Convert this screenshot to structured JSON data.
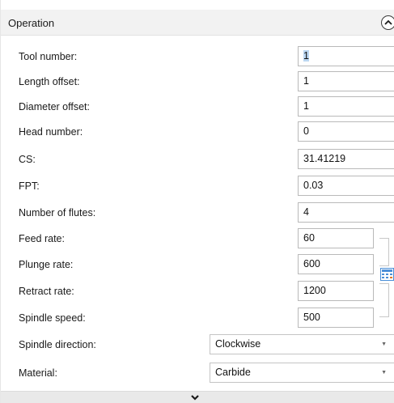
{
  "panel": {
    "title": "Operation",
    "collapse_icon": "chevron-up-icon",
    "expand_icon": "chevron-down-icon"
  },
  "fields": {
    "tool_number": {
      "label": "Tool number:",
      "value": "1"
    },
    "length_offset": {
      "label": "Length offset:",
      "value": "1"
    },
    "diameter_offset": {
      "label": "Diameter offset:",
      "value": "1"
    },
    "head_number": {
      "label": "Head number:",
      "value": "0"
    },
    "cs": {
      "label": "CS:",
      "value": "31.41219"
    },
    "fpt": {
      "label": "FPT:",
      "value": "0.03"
    },
    "number_of_flutes": {
      "label": "Number of flutes:",
      "value": "4"
    },
    "feed_rate": {
      "label": "Feed rate:",
      "value": "60"
    },
    "plunge_rate": {
      "label": "Plunge rate:",
      "value": "600"
    },
    "retract_rate": {
      "label": "Retract rate:",
      "value": "1200"
    },
    "spindle_speed": {
      "label": "Spindle speed:",
      "value": "500"
    },
    "spindle_direction": {
      "label": "Spindle direction:",
      "value": "Clockwise"
    },
    "material": {
      "label": "Material:",
      "value": "Carbide"
    }
  },
  "icons": {
    "calculator": "calculator-icon",
    "dropdown": "dropdown-arrow-icon"
  },
  "colors": {
    "header_bg": "#f2f2f2",
    "selection": "#bcd7f2",
    "calc_blue": "#4a8fd8"
  }
}
